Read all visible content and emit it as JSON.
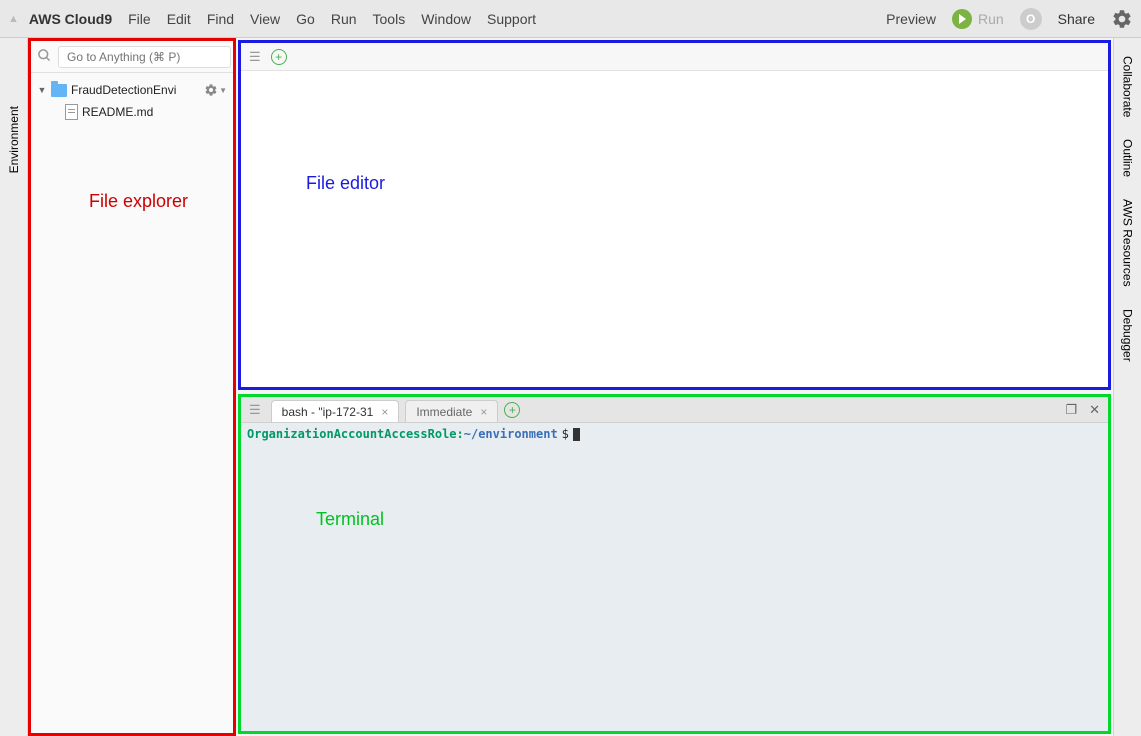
{
  "menubar": {
    "app_title": "AWS Cloud9",
    "items": [
      "File",
      "Edit",
      "Find",
      "View",
      "Go",
      "Run",
      "Tools",
      "Window",
      "Support"
    ],
    "preview": "Preview",
    "run": "Run",
    "avatar_initial": "O",
    "share": "Share"
  },
  "left_sidebar": {
    "tabs": [
      "Environment"
    ]
  },
  "explorer": {
    "search_placeholder": "Go to Anything (⌘ P)",
    "root_folder": "FraudDetectionEnvi",
    "files": [
      "README.md"
    ],
    "annotation": "File explorer"
  },
  "editor": {
    "annotation": "File editor"
  },
  "terminal": {
    "tabs": [
      {
        "label": "bash - \"ip-172-31",
        "active": true
      },
      {
        "label": "Immediate",
        "active": false
      }
    ],
    "prompt_role": "OrganizationAccountAccessRole",
    "prompt_sep": ":",
    "prompt_path": "~/environment",
    "prompt_symbol": " $",
    "annotation": "Terminal"
  },
  "right_sidebar": {
    "tabs": [
      "Collaborate",
      "Outline",
      "AWS Resources",
      "Debugger"
    ]
  }
}
